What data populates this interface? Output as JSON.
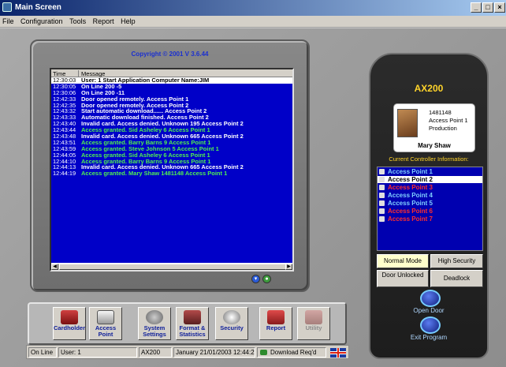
{
  "window": {
    "title": "Main Screen",
    "controls": [
      "_",
      "□",
      "×"
    ]
  },
  "menu": [
    "File",
    "Configuration",
    "Tools",
    "Report",
    "Help"
  ],
  "monitor": {
    "copyright": "Copyright © 2001 V 3.6.44",
    "columns": [
      "Time",
      "Message"
    ],
    "rows": [
      {
        "time": "12:30:03",
        "msg": "User: 1 Start Application   Computer Name:JIM",
        "color": "#ffffff",
        "selected": true
      },
      {
        "time": "12:30:05",
        "msg": "On Line   200 -5",
        "color": "#ffffff"
      },
      {
        "time": "12:30:06",
        "msg": "On Line   200 -11",
        "color": "#ffffff"
      },
      {
        "time": "12:42:33",
        "msg": "Door opened remotely.  Access Point 1",
        "color": "#ffffff"
      },
      {
        "time": "12:42:35",
        "msg": "Door opened remotely.  Access Point 2",
        "color": "#ffffff"
      },
      {
        "time": "12:43:32",
        "msg": "Start automatic download......  Access Point 2",
        "color": "#ffffff"
      },
      {
        "time": "12:43:33",
        "msg": "Automatic download finished.  Access Point 2",
        "color": "#ffffff"
      },
      {
        "time": "12:43:40",
        "msg": "Invalid card. Access denied. Unknown 195 Access Point 2",
        "color": "#ffffff"
      },
      {
        "time": "12:43:44",
        "msg": "Access granted. Sid Asheley  6 Access Point 1",
        "color": "#50f050"
      },
      {
        "time": "12:43:48",
        "msg": "Invalid card. Access denied. Unknown 665 Access Point 2",
        "color": "#ffffff"
      },
      {
        "time": "12:43:51",
        "msg": "Access granted. Barry Barns  9 Access Point 1",
        "color": "#50f050"
      },
      {
        "time": "12:43:59",
        "msg": "Access granted. Steve Johnson  5 Access Point 1",
        "color": "#50f050"
      },
      {
        "time": "12:44:05",
        "msg": "Access granted. Sid Asheley  6 Access Point 1",
        "color": "#50f050"
      },
      {
        "time": "12:44:10",
        "msg": "Access granted. Barry Barns  9 Access Point 1",
        "color": "#50f050"
      },
      {
        "time": "12:44:13",
        "msg": "Invalid card. Access denied. Unknown 665 Access Point 2",
        "color": "#ffffff"
      },
      {
        "time": "12:44:19",
        "msg": "Access granted. Mary Shaw  1481148 Access Point 1",
        "color": "#50f050"
      }
    ]
  },
  "toolbar": {
    "buttons": [
      {
        "label": "Cardholder",
        "icon": "cardholder-icon",
        "enabled": true
      },
      {
        "label": "Access Point",
        "icon": "door-icon",
        "enabled": true
      },
      {
        "label": "System Settings",
        "icon": "system-settings-icon",
        "enabled": true
      },
      {
        "label": "Format & Statistics",
        "icon": "statistics-icon",
        "enabled": true
      },
      {
        "label": "Security",
        "icon": "security-icon",
        "enabled": true
      },
      {
        "label": "Report",
        "icon": "report-icon",
        "enabled": true
      },
      {
        "label": "Utility",
        "icon": "utility-icon",
        "enabled": false
      }
    ]
  },
  "status": {
    "state": "On Line",
    "user": "User: 1",
    "controller": "AX200",
    "datetime": "January 21/01/2003 12:44:28",
    "download": "Download Req'd",
    "flag_icon": "uk-flag-icon"
  },
  "panel": {
    "model": "AX200",
    "card": {
      "id": "1481148",
      "access_point": "Access Point 1",
      "department": "Production",
      "name": "Mary Shaw"
    },
    "controller_info_label": "Current Controller Information:",
    "access_points": [
      {
        "label": "Access Point 1",
        "color": "#7fd0ff",
        "selected": false
      },
      {
        "label": "Access Point 2",
        "color": "#000000",
        "selected": true
      },
      {
        "label": "Access Point 3",
        "color": "#ff2d2d",
        "selected": false
      },
      {
        "label": "Access Point 4",
        "color": "#7fd0ff",
        "selected": false
      },
      {
        "label": "Access Point 5",
        "color": "#7fd0ff",
        "selected": false
      },
      {
        "label": "Access Point 6",
        "color": "#ff2d2d",
        "selected": false
      },
      {
        "label": "Access Point 7",
        "color": "#ff2d2d",
        "selected": false
      }
    ],
    "mode_normal": "Normal Mode",
    "mode_high": "High Security",
    "door_unlocked": "Door Unlocked",
    "deadlock": "Deadlock",
    "open_door": "Open Door",
    "exit_program": "Exit Program"
  }
}
